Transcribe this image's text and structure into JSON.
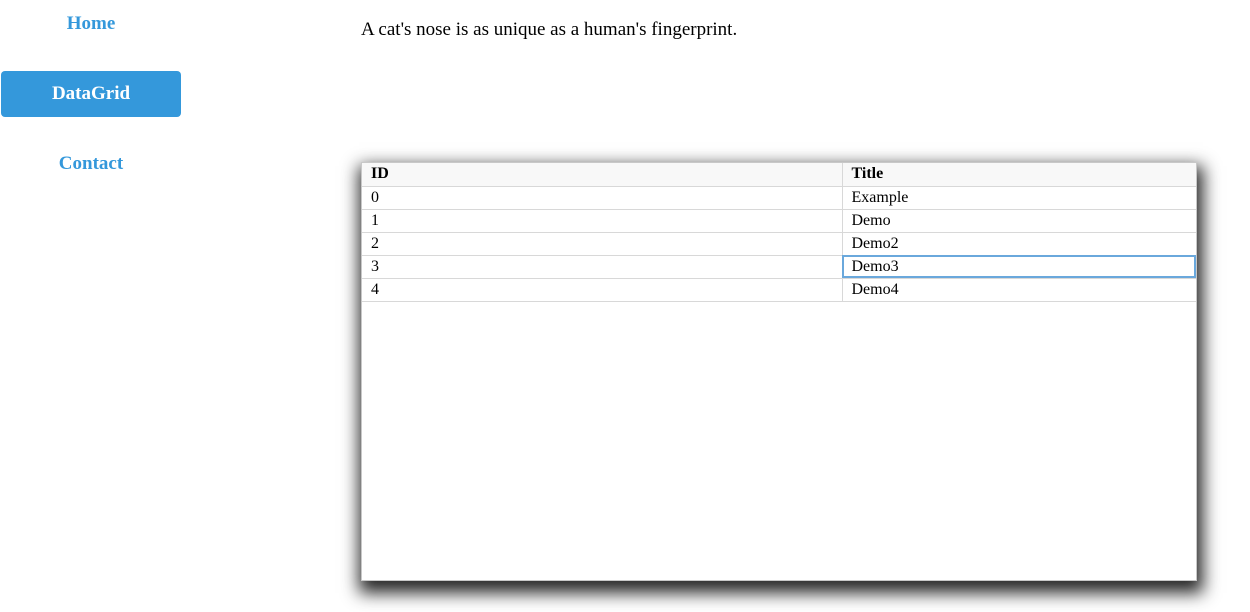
{
  "nav": {
    "items": [
      {
        "label": "Home",
        "active": false
      },
      {
        "label": "DataGrid",
        "active": true
      },
      {
        "label": "Contact",
        "active": false
      }
    ]
  },
  "main": {
    "fact": "A cat's nose is as unique as a human's fingerprint."
  },
  "grid": {
    "columns": [
      "ID",
      "Title"
    ],
    "rows": [
      [
        "0",
        "Example"
      ],
      [
        "1",
        "Demo"
      ],
      [
        "2",
        "Demo2"
      ],
      [
        "3",
        "Demo3"
      ],
      [
        "4",
        "Demo4"
      ]
    ],
    "selected_cell": {
      "row": 3,
      "column": 1
    }
  },
  "colors": {
    "accent": "#3498db",
    "selection_border": "#6aa8dc"
  }
}
